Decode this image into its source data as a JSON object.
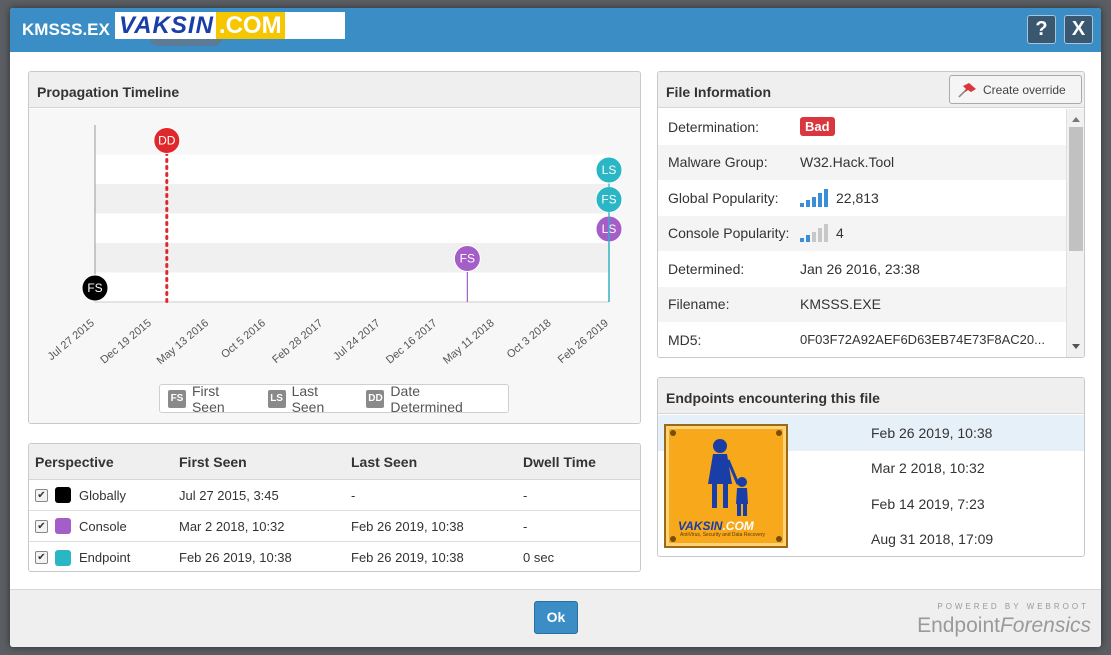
{
  "window": {
    "title": "KMSSS.EX",
    "watermark_a": "VAKSIN",
    "watermark_b": ".COM",
    "help_label": "?",
    "close_label": "X"
  },
  "timeline": {
    "title": "Propagation Timeline",
    "axis_labels": [
      "Jul 27 2015",
      "Dec 19 2015",
      "May 13 2016",
      "Oct 5 2016",
      "Feb 28 2017",
      "Jul 24 2017",
      "Dec 16 2017",
      "May 11 2018",
      "Oct 3 2018",
      "Feb 26 2019"
    ],
    "markers": [
      {
        "label": "FS",
        "date": "Jul 27 2015",
        "row": 0,
        "color": "#000000"
      },
      {
        "label": "DD",
        "date": "Jan 26 2016",
        "row": 5,
        "color": "#e0272c"
      },
      {
        "label": "FS",
        "date": "Mar 2 2018",
        "row": 1,
        "color": "#a55dc8"
      },
      {
        "label": "LS",
        "date": "Feb 26 2019",
        "row": 2,
        "color": "#a55dc8"
      },
      {
        "label": "FS",
        "date": "Feb 26 2019",
        "row": 3,
        "color": "#2ab6c4"
      },
      {
        "label": "LS",
        "date": "Feb 26 2019",
        "row": 4,
        "color": "#2ab6c4"
      }
    ],
    "legend": [
      {
        "abbr": "FS",
        "label": "First Seen"
      },
      {
        "abbr": "LS",
        "label": "Last Seen"
      },
      {
        "abbr": "DD",
        "label": "Date Determined"
      }
    ]
  },
  "perspective": {
    "headers": [
      "Perspective",
      "First Seen",
      "Last Seen",
      "Dwell Time"
    ],
    "rows": [
      {
        "name": "Globally",
        "color": "#000000",
        "first": "Jul 27 2015, 3:45",
        "last": "-",
        "dwell": "-"
      },
      {
        "name": "Console",
        "color": "#a55dc8",
        "first": "Mar 2 2018, 10:32",
        "last": "Feb 26 2019, 10:38",
        "dwell": "-"
      },
      {
        "name": "Endpoint",
        "color": "#2ab6c4",
        "first": "Feb 26 2019, 10:38",
        "last": "Feb 26 2019, 10:38",
        "dwell": "0 sec"
      }
    ]
  },
  "file_info": {
    "title": "File Information",
    "override_label": "Create override",
    "rows": [
      {
        "label": "Determination:",
        "value": "Bad"
      },
      {
        "label": "Malware Group:",
        "value": "W32.Hack.Tool"
      },
      {
        "label": "Global Popularity:",
        "value": "22,813",
        "level": 5
      },
      {
        "label": "Console Popularity:",
        "value": "4",
        "level": 2
      },
      {
        "label": "Determined:",
        "value": "Jan 26 2016, 23:38"
      },
      {
        "label": "Filename:",
        "value": "KMSSS.EXE"
      },
      {
        "label": "MD5:",
        "value": "0F03F72A92AEF6D63EB74E73F8AC20..."
      }
    ]
  },
  "endpoints": {
    "title": "Endpoints encountering this file",
    "rows": [
      {
        "date": "Feb 26 2019, 10:38",
        "selected": true
      },
      {
        "date": "Mar 2 2018, 10:32",
        "selected": false
      },
      {
        "date": "Feb 14 2019, 7:23",
        "selected": false
      },
      {
        "date": "Aug 31 2018, 17:09",
        "selected": false
      }
    ],
    "logo_a": "VAKSIN",
    "logo_b": ".COM",
    "logo_sub": "AntiVirus, Security and Data Recovery"
  },
  "footer": {
    "ok_label": "Ok",
    "powered": "POWERED BY WEBROOT",
    "brand_a": "Endpoint",
    "brand_b": "Forensics"
  },
  "colors": {
    "accent": "#3a8dc5",
    "bad": "#d9363e",
    "pop_blue": "#3a8dd8",
    "pop_gray": "#c8c8c8"
  }
}
